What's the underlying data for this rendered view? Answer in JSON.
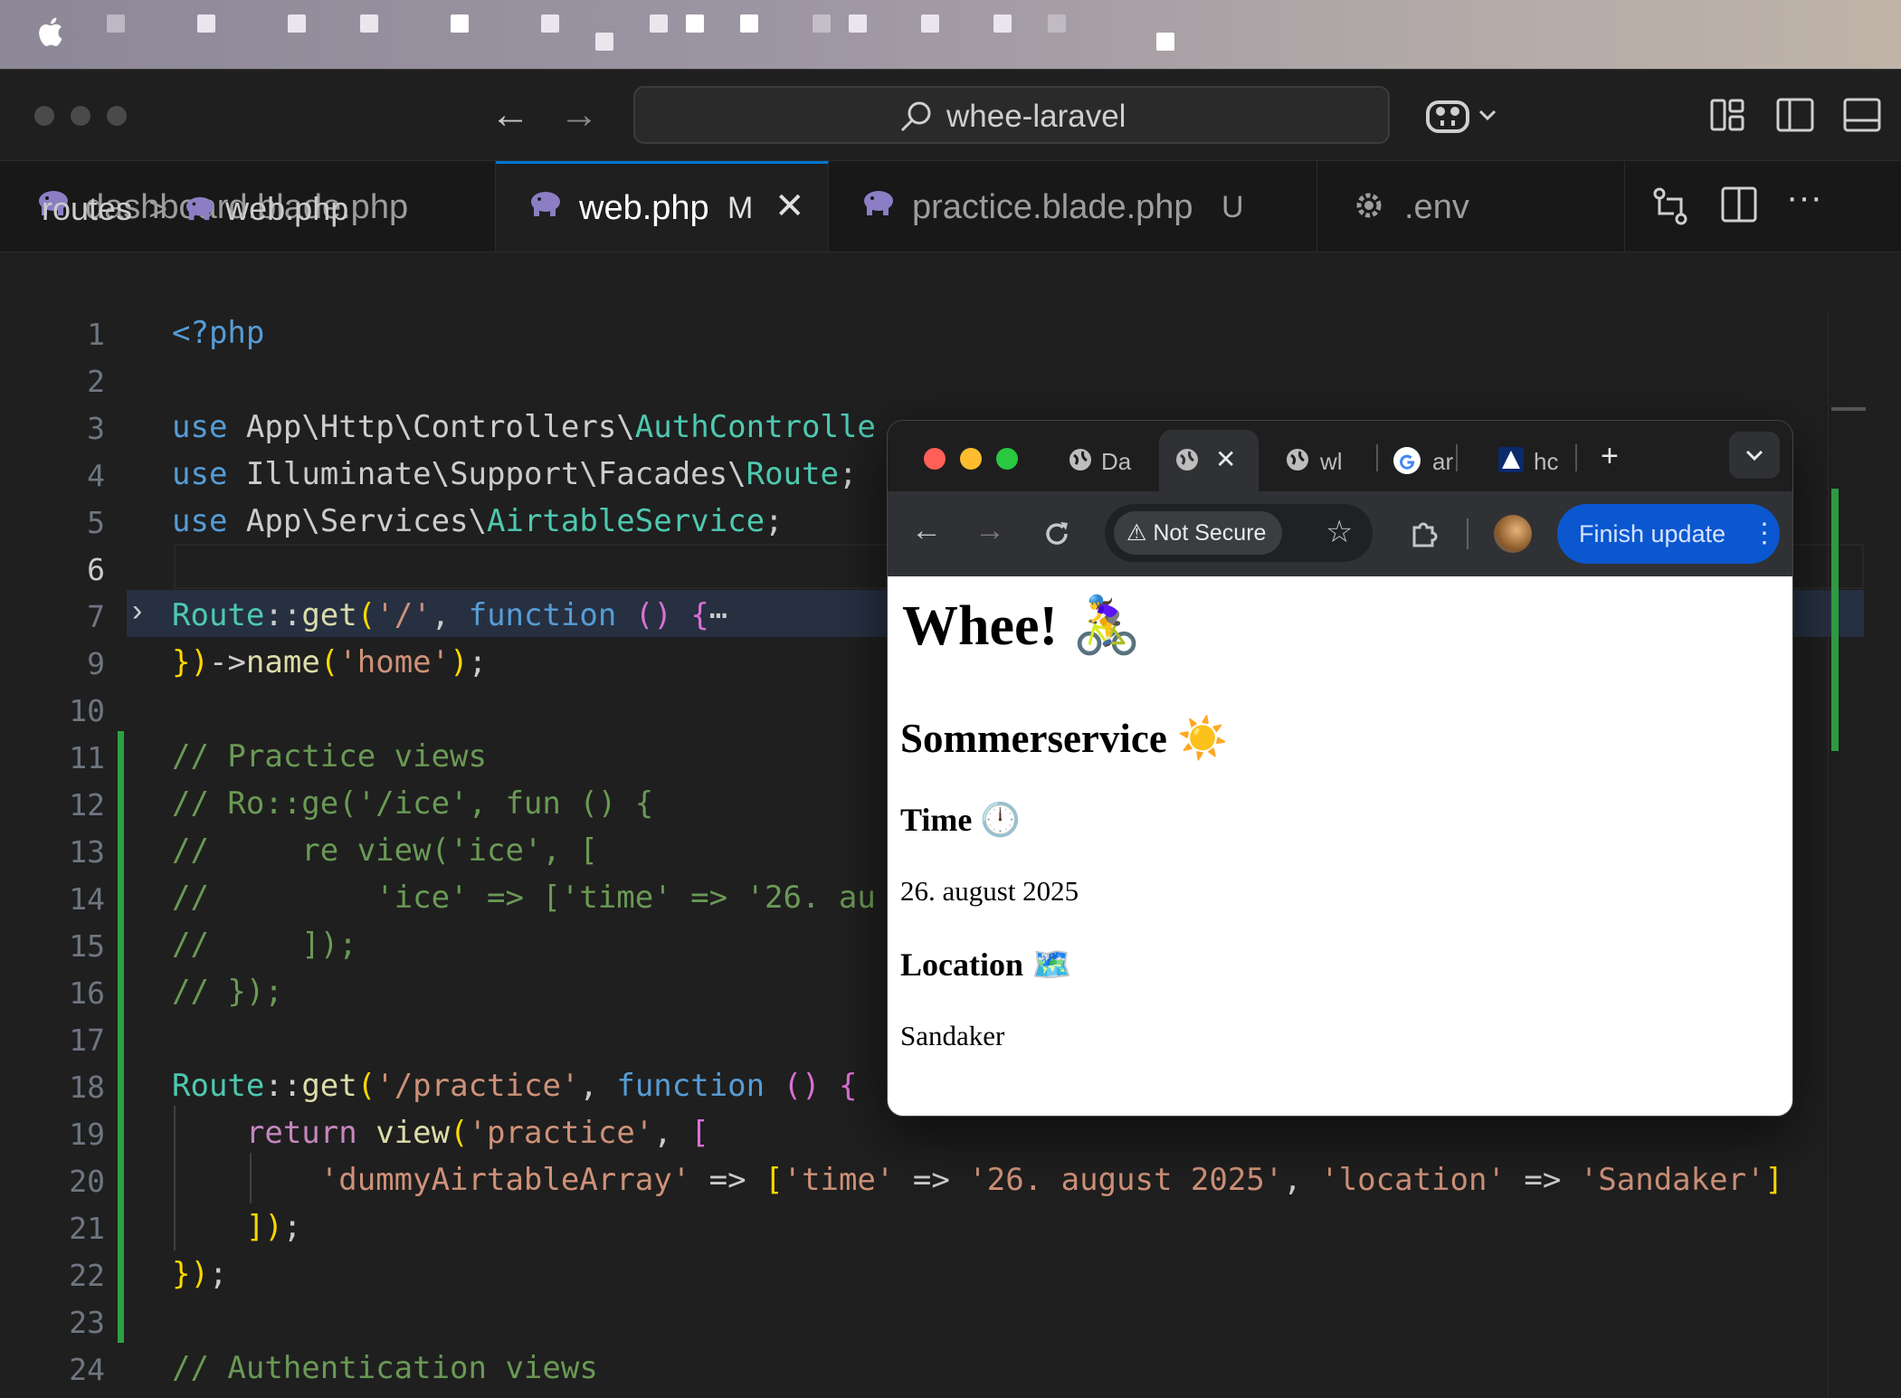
{
  "window": {
    "title": "whee-laravel"
  },
  "tabs": [
    {
      "label": "dashboard.blade.php",
      "badge": ""
    },
    {
      "label": "web.php",
      "badge": "M"
    },
    {
      "label": "practice.blade.php",
      "badge": "U"
    },
    {
      "label": ".env",
      "badge": ""
    }
  ],
  "breadcrumb": {
    "folder": "routes",
    "separator": ">",
    "file": "web.php"
  },
  "lines": [
    {
      "n": "1",
      "code": "<?php"
    },
    {
      "n": "2",
      "code": ""
    },
    {
      "n": "3",
      "code": "use App\\Http\\Controllers\\AuthControlle"
    },
    {
      "n": "4",
      "code": "use Illuminate\\Support\\Facades\\Route;"
    },
    {
      "n": "5",
      "code": "use App\\Services\\AirtableService;"
    },
    {
      "n": "6",
      "code": ""
    },
    {
      "n": "7",
      "code": "Route::get('/', function () {⋯"
    },
    {
      "n": "9",
      "code": "})->name('home');"
    },
    {
      "n": "10",
      "code": ""
    },
    {
      "n": "11",
      "code": "// Practice views"
    },
    {
      "n": "12",
      "code": "// Ro::ge('/ice', fun () {"
    },
    {
      "n": "13",
      "code": "//     re view('ice', ["
    },
    {
      "n": "14",
      "code": "//         'ice' => ['time' => '26. au"
    },
    {
      "n": "15",
      "code": "//     ]);"
    },
    {
      "n": "16",
      "code": "// });"
    },
    {
      "n": "17",
      "code": ""
    },
    {
      "n": "18",
      "code": "Route::get('/practice', function () {"
    },
    {
      "n": "19",
      "code": "    return view('practice', ["
    },
    {
      "n": "20",
      "code": "        'dummyAirtableArray' => ['time' => '26. august 2025', 'location' => 'Sandaker']"
    },
    {
      "n": "21",
      "code": "    ]);"
    },
    {
      "n": "22",
      "code": "});"
    },
    {
      "n": "23",
      "code": ""
    },
    {
      "n": "24",
      "code": "// Authentication views"
    }
  ],
  "browser": {
    "tabs": [
      "Da",
      "",
      "wl",
      "ar",
      "hc"
    ],
    "security_label": "Not Secure",
    "update_button": "Finish update",
    "new_tab": "+"
  },
  "page": {
    "heading": "Whee! 🚴‍♀️",
    "subheading": "Sommerservice ☀️",
    "time_label": "Time 🕛",
    "time_value": "26. august 2025",
    "location_label": "Location 🗺️",
    "location_value": "Sandaker"
  },
  "colors": {
    "accent": "#0078d4",
    "git_added": "#2ea043",
    "chrome_update": "#0b57d0"
  }
}
